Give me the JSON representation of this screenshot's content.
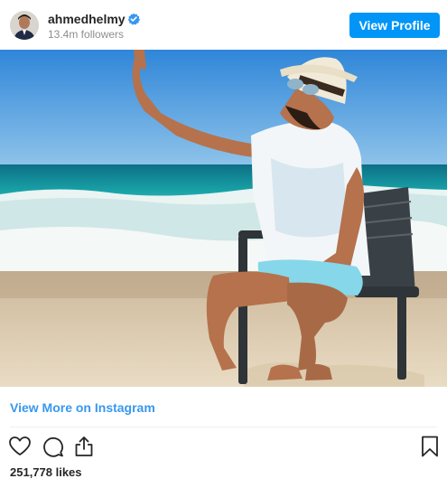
{
  "header": {
    "username": "ahmedhelmy",
    "verified": true,
    "followers": "13.4m followers",
    "view_profile_label": "View Profile"
  },
  "post": {
    "image_alt": "Man in straw hat sitting on a chair at the beach",
    "view_more_label": "View More on Instagram",
    "likes": "251,778 likes"
  },
  "actions": {
    "icons": [
      "heart-icon",
      "comment-icon",
      "share-icon",
      "bookmark-icon"
    ]
  },
  "colors": {
    "accent": "#0095f6",
    "link": "#3897f0",
    "text": "#262626",
    "muted": "#8e8e8e",
    "verified": "#3897f0"
  }
}
